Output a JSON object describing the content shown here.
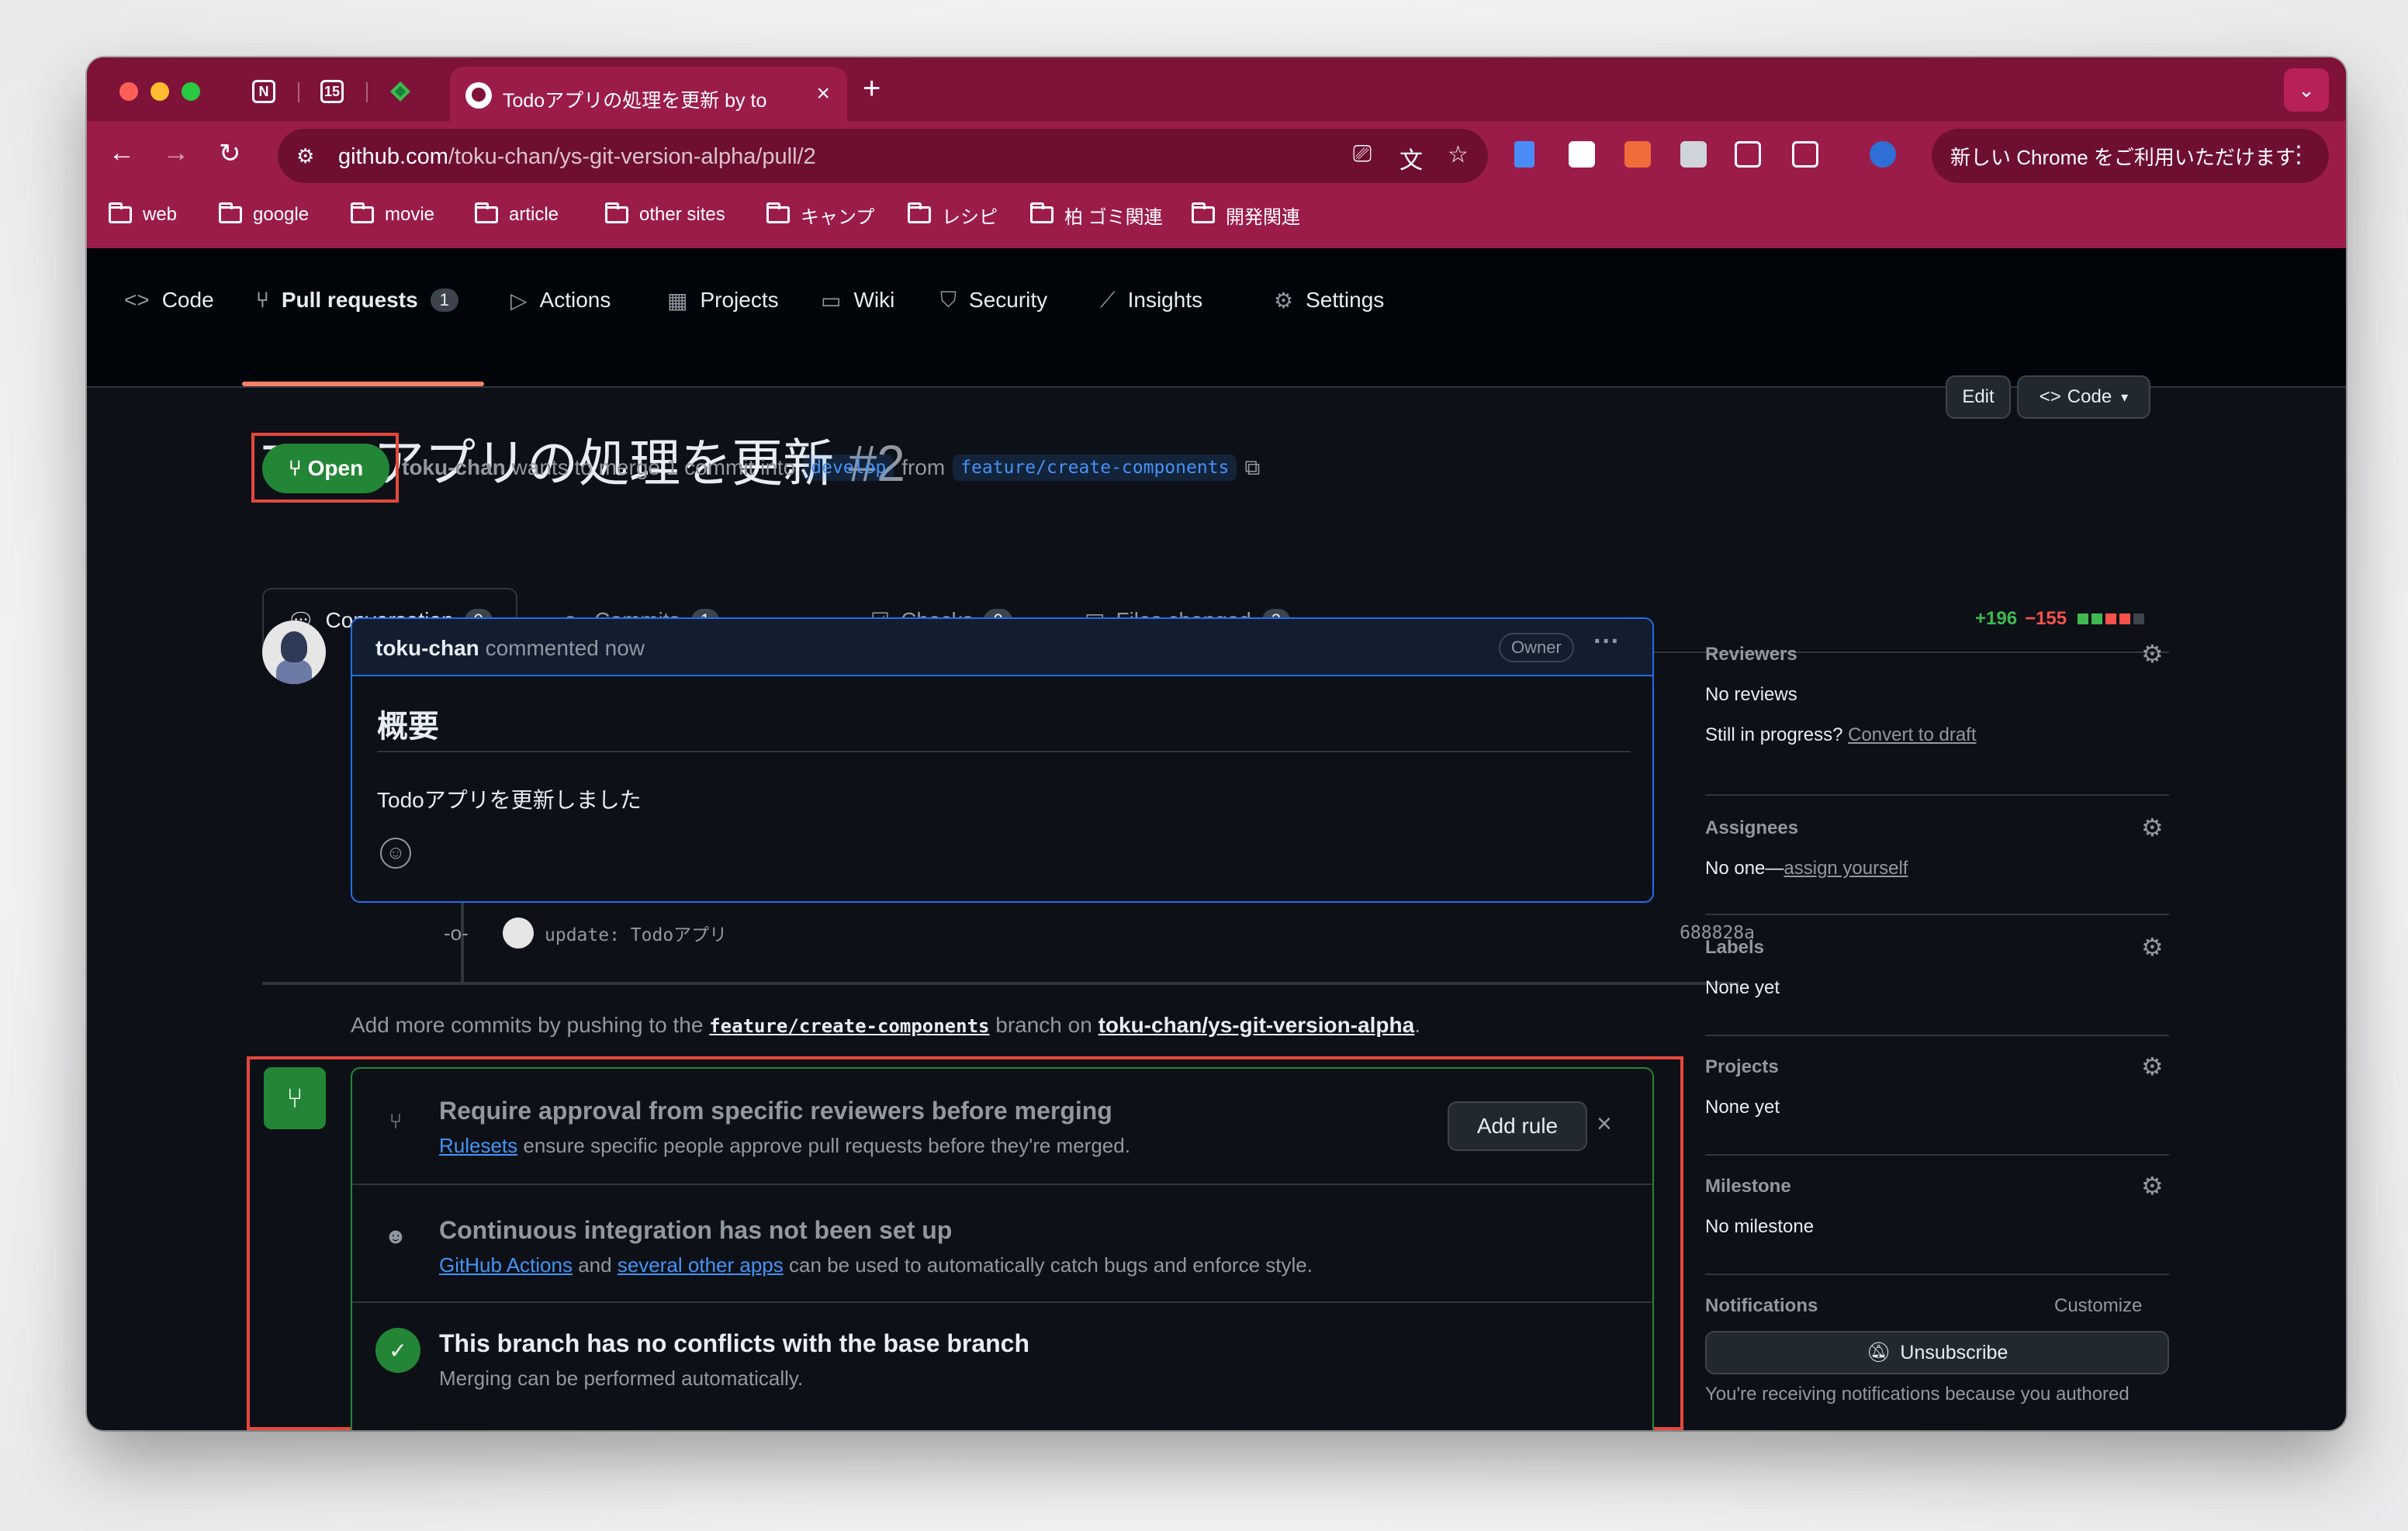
{
  "browser": {
    "active_tab_title": "Todoアプリの処理を更新 by tok",
    "url_host": "github.com",
    "url_path": "/toku-chan/ys-git-version-alpha/pull/2",
    "chrome_banner": "新しい Chrome をご利用いただけます",
    "bookmarks": [
      "web",
      "google",
      "movie",
      "article",
      "other sites",
      "キャンプ",
      "レシピ",
      "柏 ゴミ関連",
      "開発関連"
    ]
  },
  "repo_nav": {
    "tabs": [
      {
        "label": "Code",
        "icon": "code-icon"
      },
      {
        "label": "Pull requests",
        "icon": "pull-request-icon",
        "count": "1"
      },
      {
        "label": "Actions",
        "icon": "play-icon"
      },
      {
        "label": "Projects",
        "icon": "table-icon"
      },
      {
        "label": "Wiki",
        "icon": "book-icon"
      },
      {
        "label": "Security",
        "icon": "shield-icon"
      },
      {
        "label": "Insights",
        "icon": "graph-icon"
      },
      {
        "label": "Settings",
        "icon": "gear-icon"
      }
    ]
  },
  "pr": {
    "title": "Todoアプリの処理を更新",
    "number": "#2",
    "edit_label": "Edit",
    "code_label": "Code",
    "state": "Open",
    "author": "toku-chan",
    "merge_text": "wants to merge 1 commit into",
    "base_branch": "develop",
    "from_text": "from",
    "head_branch": "feature/create-components",
    "tabs": [
      {
        "label": "Conversation",
        "count": "0"
      },
      {
        "label": "Commits",
        "count": "1"
      },
      {
        "label": "Checks",
        "count": "0"
      },
      {
        "label": "Files changed",
        "count": "3"
      }
    ],
    "additions": "+196",
    "deletions": "−155"
  },
  "comment": {
    "author": "toku-chan",
    "action": "commented now",
    "badge": "Owner",
    "heading": "概要",
    "body": "Todoアプリを更新しました"
  },
  "commit": {
    "message": "update: Todoアプリ",
    "sha": "688828a"
  },
  "add_more": {
    "prefix": "Add more commits by pushing to the",
    "branch": "feature/create-components",
    "middle": "branch on",
    "repo": "toku-chan/ys-git-version-alpha",
    "suffix": "."
  },
  "merge_box": {
    "rule": {
      "title": "Require approval from specific reviewers before merging",
      "link": "Rulesets",
      "desc": "ensure specific people approve pull requests before they're merged.",
      "button": "Add rule"
    },
    "ci": {
      "title": "Continuous integration has not been set up",
      "link1": "GitHub Actions",
      "and": "and",
      "link2": "several other apps",
      "desc": "can be used to automatically catch bugs and enforce style."
    },
    "conflicts": {
      "title": "This branch has no conflicts with the base branch",
      "desc": "Merging can be performed automatically."
    }
  },
  "sidebar": {
    "reviewers_label": "Reviewers",
    "reviewers_value": "No reviews",
    "draft_q": "Still in progress?",
    "draft_link": "Convert to draft",
    "assignees_label": "Assignees",
    "assignees_value": "No one—",
    "assignees_link": "assign yourself",
    "labels_label": "Labels",
    "labels_value": "None yet",
    "projects_label": "Projects",
    "projects_value": "None yet",
    "milestone_label": "Milestone",
    "milestone_value": "No milestone",
    "notifications_label": "Notifications",
    "customize": "Customize",
    "unsubscribe": "Unsubscribe",
    "notif_text": "You're receiving notifications because you authored"
  },
  "colors": {
    "chrome_frame": "#9c1c49",
    "github_bg": "#0d1117",
    "open_green": "#238636",
    "highlight_red": "#e5483c",
    "link_blue": "#4493f8"
  }
}
